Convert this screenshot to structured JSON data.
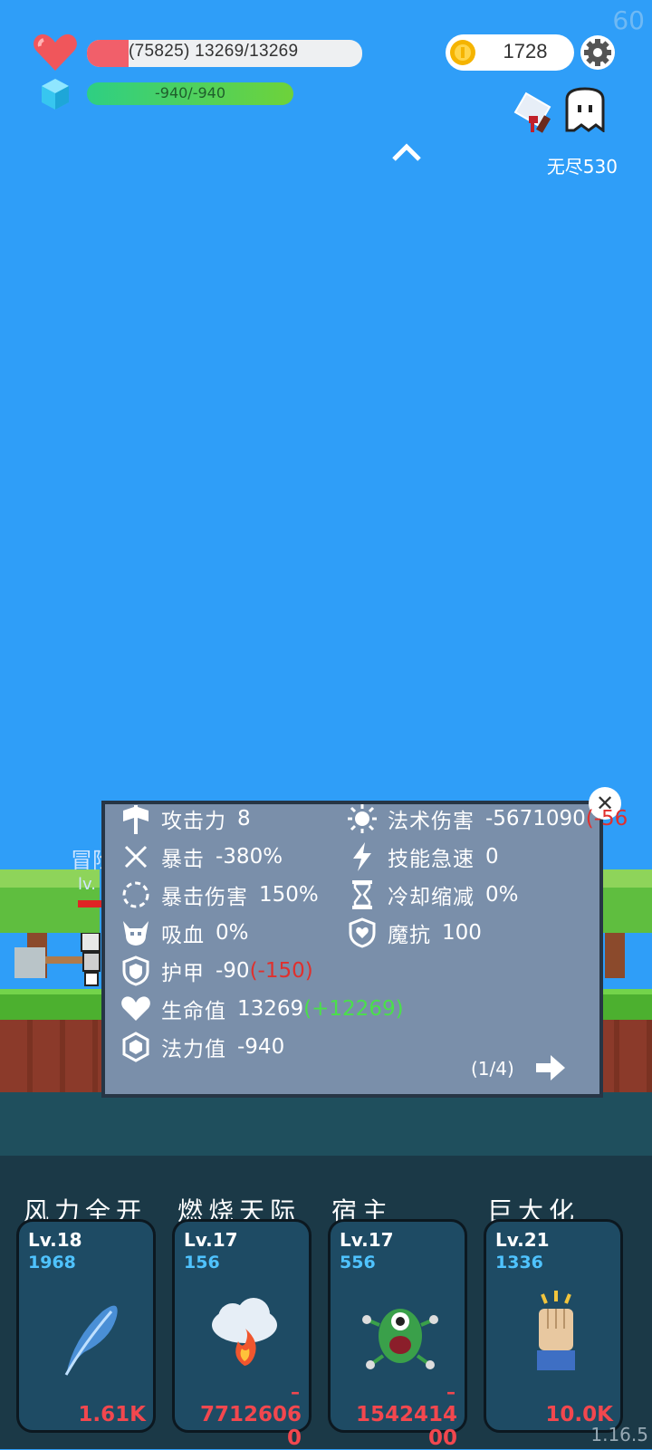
{
  "hud": {
    "fps": "60",
    "hp_text": "(75825) 13269/13269",
    "mp_text": "-940/-940",
    "coins": "1728",
    "endless_label": "无尽530"
  },
  "npc": {
    "name": "冒险",
    "level": "lv."
  },
  "stats_panel": {
    "left": [
      {
        "icon": "axe-icon",
        "label": "攻击力",
        "value": "8",
        "extra": ""
      },
      {
        "icon": "crossed-swords-icon",
        "label": "暴击",
        "value": "-380%",
        "extra": ""
      },
      {
        "icon": "crit-target-icon",
        "label": "暴击伤害",
        "value": "150%",
        "extra": ""
      },
      {
        "icon": "vampire-skull-icon",
        "label": "吸血",
        "value": "0%",
        "extra": ""
      },
      {
        "icon": "shield-icon",
        "label": "护甲",
        "value": "-90",
        "extra": "(-150)"
      },
      {
        "icon": "heart-icon",
        "label": "生命值",
        "value": "13269",
        "extra": "(+12269)"
      },
      {
        "icon": "gem-icon",
        "label": "法力值",
        "value": "-940",
        "extra": ""
      }
    ],
    "right": [
      {
        "icon": "sun-icon",
        "label": "法术伤害",
        "value": "-5671090",
        "extra": "(-56"
      },
      {
        "icon": "lightning-icon",
        "label": "技能急速",
        "value": "0",
        "extra": ""
      },
      {
        "icon": "hourglass-icon",
        "label": "冷却缩减",
        "value": "0%",
        "extra": ""
      },
      {
        "icon": "magic-shield-icon",
        "label": "魔抗",
        "value": "100",
        "extra": ""
      }
    ],
    "page": "(1/4)"
  },
  "skills": [
    {
      "title": "风力全开",
      "level": "Lv.18",
      "cost": "1968",
      "damage": "1.61K",
      "dash": "",
      "overflow": "",
      "icon": "feather-icon"
    },
    {
      "title": "燃烧天际",
      "level": "Lv.17",
      "cost": "156",
      "damage": "7712606",
      "dash": "–",
      "overflow": "0",
      "icon": "fire-cloud-icon"
    },
    {
      "title": "宿主",
      "level": "Lv.17",
      "cost": "556",
      "damage": "1542414",
      "dash": "–",
      "overflow": "00",
      "icon": "parasite-monster-icon"
    },
    {
      "title": "巨大化",
      "level": "Lv.21",
      "cost": "1336",
      "damage": "10.0K",
      "dash": "",
      "overflow": "",
      "icon": "fist-icon"
    }
  ],
  "version": "1.16.5",
  "colors": {
    "sky": "#2f9ef8",
    "hp": "#f15f6a",
    "panel": "#7a8faa",
    "negative": "#e0302d",
    "positive": "#4ae04a",
    "cost": "#4fc3ff"
  },
  "progress": {
    "hp_fill_fraction": 0.15
  }
}
